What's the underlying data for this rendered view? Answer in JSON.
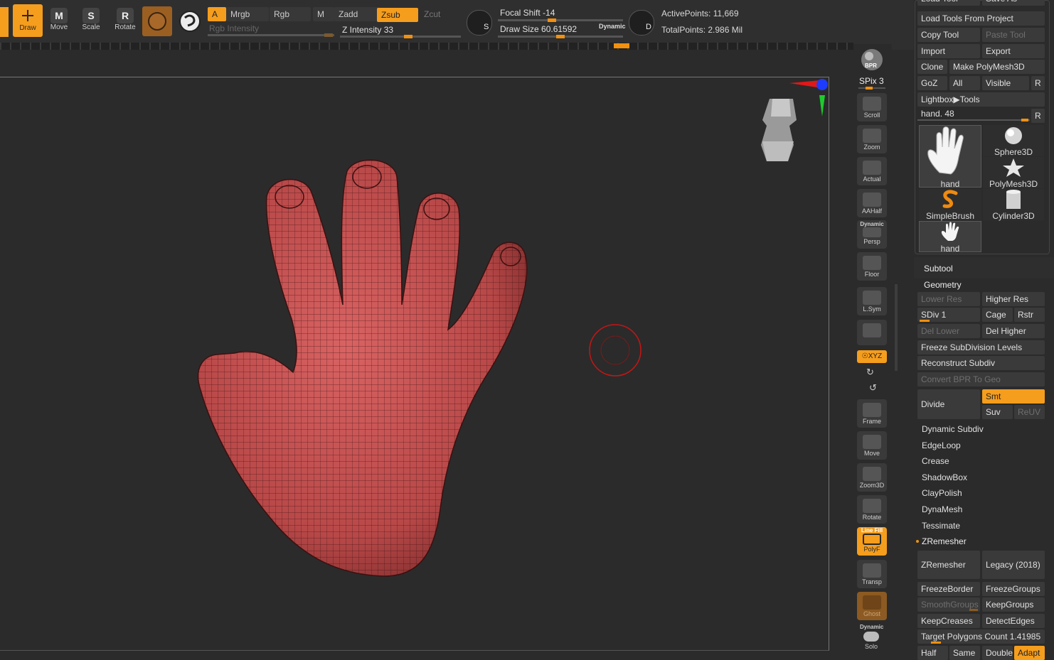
{
  "toolbar": {
    "draw_label": "Draw",
    "move_label": "Move",
    "scale_label": "Scale",
    "rotate_label": "Rotate",
    "move_key": "M",
    "scale_key": "S",
    "rotate_key": "R",
    "a_label": "A",
    "mrgb_label": "Mrgb",
    "rgb_label": "Rgb",
    "m_label": "M",
    "zadd_label": "Zadd",
    "zsub_label": "Zsub",
    "zcut_label": "Zcut",
    "rgb_intensity_label": "Rgb Intensity",
    "z_intensity_label": "Z Intensity 33",
    "z_intensity_value": 33,
    "focal_shift_label": "Focal Shift -14",
    "focal_shift_value": -14,
    "draw_size_label": "Draw Size 60.61592",
    "draw_size_value": 60.61592,
    "dynamic_label": "Dynamic",
    "s_label": "S",
    "d_label": "D",
    "active_points": "ActivePoints: 11,669",
    "total_points": "TotalPoints: 2.986 Mil"
  },
  "shelf": {
    "bpr": "BPR",
    "spix": "SPix 3",
    "scroll": "Scroll",
    "zoom": "Zoom",
    "actual": "Actual",
    "aahalf": "AAHalf",
    "dynamic_persp": "Dynamic",
    "persp": "Persp",
    "floor": "Floor",
    "lsym": "L.Sym",
    "xyz": "☉XYZ",
    "frame": "Frame",
    "move": "Move",
    "zoom3d": "Zoom3D",
    "rotate": "Rotate",
    "line_fill": "Line Fill",
    "polyf": "PolyF",
    "transp": "Transp",
    "ghost": "Ghost",
    "dynamic_solo": "Dynamic",
    "solo": "Solo"
  },
  "tool_panel": {
    "load_tool": "Load Tool",
    "save_as": "Save As",
    "load_tools_from_project": "Load Tools From Project",
    "copy_tool": "Copy Tool",
    "paste_tool": "Paste Tool",
    "import": "Import",
    "export": "Export",
    "clone": "Clone",
    "make_polymesh": "Make PolyMesh3D",
    "goz": "GoZ",
    "all": "All",
    "visible": "Visible",
    "r": "R",
    "lightbox_tools": "Lightbox▶Tools",
    "hand_slider": "hand. 48",
    "tools": [
      {
        "name": "hand",
        "icon": "hand-icon"
      },
      {
        "name": "Sphere3D",
        "icon": "sphere-icon"
      },
      {
        "name": "PolyMesh3D",
        "icon": "star-icon"
      },
      {
        "name": "SimpleBrush",
        "icon": "s-brush-icon"
      },
      {
        "name": "Cylinder3D",
        "icon": "cylinder-icon"
      },
      {
        "name": "hand",
        "icon": "hand-icon"
      }
    ]
  },
  "subtool": {
    "subtool_label": "Subtool",
    "geometry_label": "Geometry",
    "lower_res": "Lower Res",
    "higher_res": "Higher Res",
    "sdiv": "SDiv 1",
    "cage": "Cage",
    "rstr": "Rstr",
    "del_lower": "Del Lower",
    "del_higher": "Del Higher",
    "freeze_subdiv": "Freeze SubDivision Levels",
    "reconstruct_subdiv": "Reconstruct Subdiv",
    "convert_bpr": "Convert BPR To Geo",
    "divide": "Divide",
    "smt": "Smt",
    "suv": "Suv",
    "reuv": "ReUV",
    "menus": [
      "Dynamic Subdiv",
      "EdgeLoop",
      "Crease",
      "ShadowBox",
      "ClayPolish",
      "DynaMesh",
      "Tessimate"
    ],
    "zremesher_header": "ZRemesher",
    "zremesher_btn": "ZRemesher",
    "legacy": "Legacy (2018)",
    "freeze_border": "FreezeBorder",
    "freeze_groups": "FreezeGroups",
    "smooth_groups": "SmoothGroups",
    "keep_groups": "KeepGroups",
    "keep_creases": "KeepCreases",
    "detect_edges": "DetectEdges",
    "target_polygons": "Target Polygons Count 1.41985",
    "half": "Half",
    "same": "Same",
    "double": "Double",
    "adapt": "Adapt"
  }
}
